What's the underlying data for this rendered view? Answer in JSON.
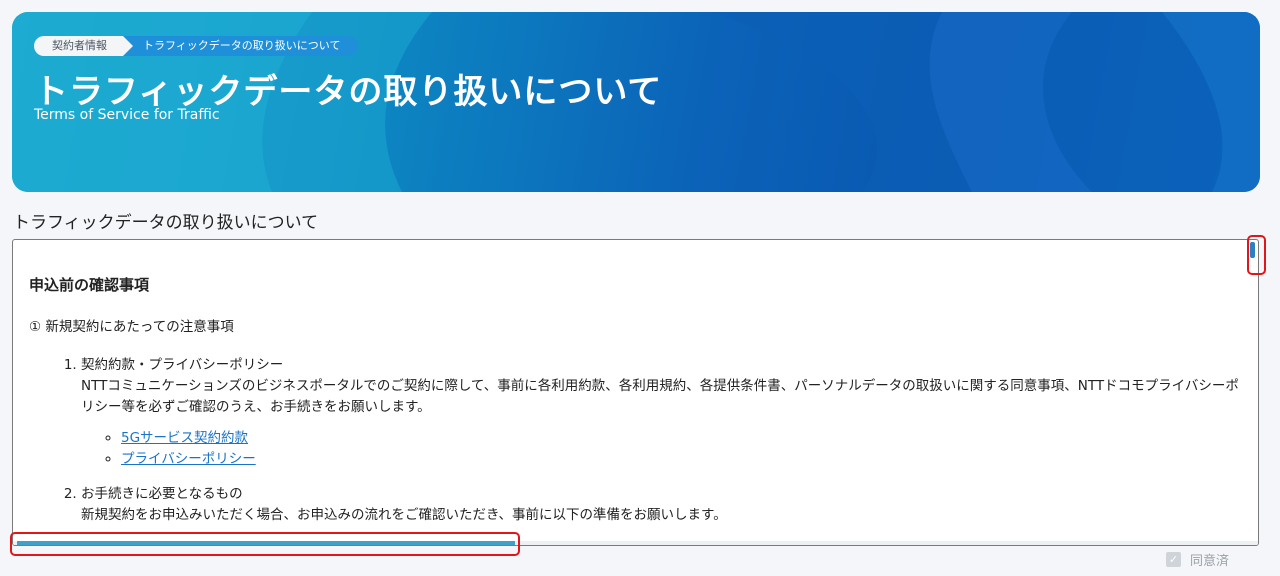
{
  "breadcrumb": {
    "items": [
      {
        "label": "契約者情報"
      },
      {
        "label": "トラフィックデータの取り扱いについて"
      }
    ]
  },
  "hero": {
    "title": "トラフィックデータの取り扱いについて",
    "subtitle": "Terms of Service for Traffic"
  },
  "section": {
    "heading": "トラフィックデータの取り扱いについて"
  },
  "content": {
    "notice_title": "申込前の確認事項",
    "sub_title": "① 新規契約にあたっての注意事項",
    "items": [
      {
        "label": "契約約款・プライバシーポリシー",
        "desc": "NTTコミュニケーションズのビジネスポータルでのご契約に際して、事前に各利用約款、各利用規約、各提供条件書、パーソナルデータの取扱いに関する同意事項、NTTドコモプライバシーポリシー等を必ずご確認のうえ、お手続きをお願いします。",
        "links": [
          {
            "label": "5Gサービス契約約款"
          },
          {
            "label": "プライバシーポリシー"
          }
        ]
      },
      {
        "label": "お手続きに必要となるもの",
        "desc": "新規契約をお申込みいただく場合、お申込みの流れをご確認いただき、事前に以下の準備をお願いします。"
      }
    ]
  },
  "agree": {
    "label": "同意済",
    "checked": true
  },
  "colors": {
    "hero_start": "#1aa0c8",
    "hero_end": "#0a57b0",
    "link": "#1a73c9",
    "highlight": "#e0161b",
    "scroll_thumb": "#3fa0cc"
  }
}
